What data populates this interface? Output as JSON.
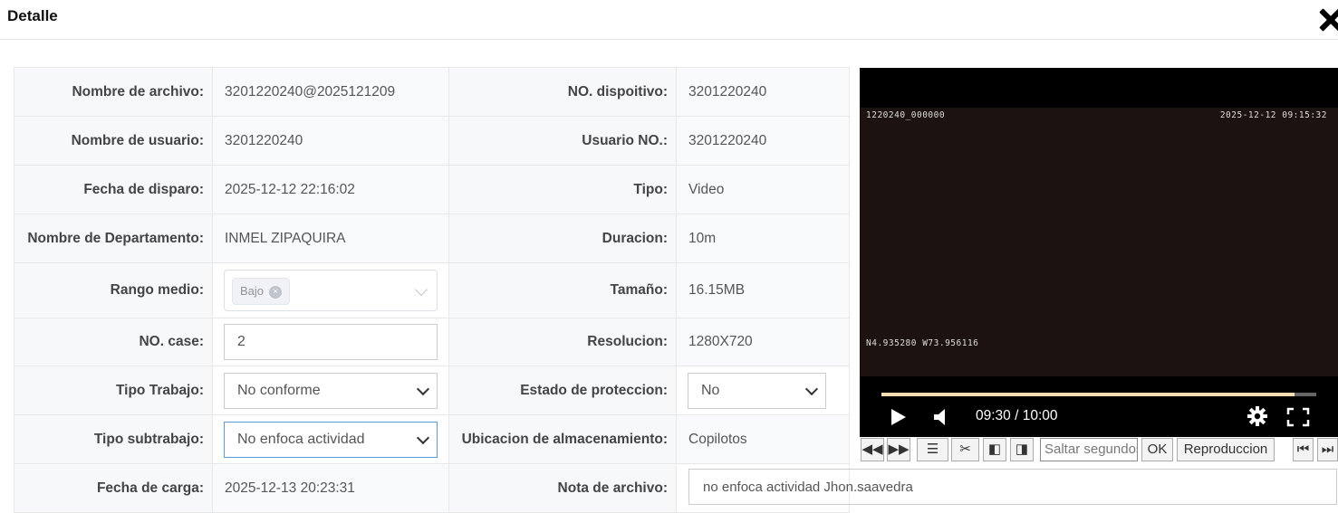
{
  "dialog": {
    "title": "Detalle"
  },
  "rows": [
    {
      "l1": "Nombre de archivo:",
      "v1": "3201220240@2025121209",
      "l2": "NO. dispoitivo:",
      "v2": "3201220240"
    },
    {
      "l1": "Nombre de usuario:",
      "v1": "3201220240",
      "l2": "Usuario NO.:",
      "v2": "3201220240"
    },
    {
      "l1": "Fecha de disparo:",
      "v1": "2025-12-12 22:16:02",
      "l2": "Tipo:",
      "v2": "Video"
    },
    {
      "l1": "Nombre de Departamento:",
      "v1": "INMEL ZIPAQUIRA",
      "l2": "Duracion:",
      "v2": "10m"
    },
    {
      "l1": "Rango medio:",
      "v1_tag": "Bajo",
      "l2": "Tamaño:",
      "v2": "16.15MB"
    },
    {
      "l1": "NO. case:",
      "v1": "2",
      "l2": "Resolucion:",
      "v2": "1280X720"
    },
    {
      "l1": "Tipo Trabajo:",
      "v1": "No conforme",
      "l2": "Estado de proteccion:",
      "v2": "No"
    },
    {
      "l1": "Tipo subtrabajo:",
      "v1": "No enfoca actividad",
      "l2": "Ubicacion de almacenamiento:",
      "v2": "Copilotos"
    },
    {
      "l1": "Fecha de carga:",
      "v1": "2025-12-13 20:23:31",
      "l2": "Nota de archivo:",
      "v2": "no enfoca actividad Jhon.saavedra"
    }
  ],
  "video": {
    "osd_top_left": "1220240_000000",
    "osd_top_right": "2025-12-12 09:15:32",
    "osd_bottom_left": "N4.935280 W73.956116",
    "time_display": "09:30 / 10:00",
    "progress_percent": 95
  },
  "toolbar": {
    "seek_placeholder": "Saltar segundos",
    "ok_label": "OK",
    "playback_label": "Reproduccion",
    "icons": [
      "rewind-icon",
      "fast-forward-icon",
      "list-icon",
      "scissors-icon",
      "prev-frame-icon",
      "next-frame-icon",
      "skip-start-icon",
      "skip-end-icon"
    ]
  }
}
